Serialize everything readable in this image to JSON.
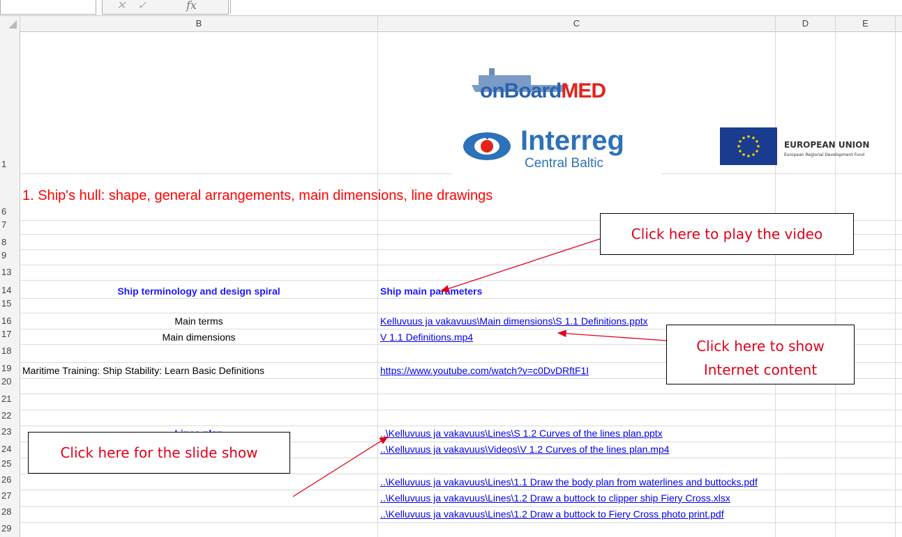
{
  "formula_bar": {
    "fx_label": "fx"
  },
  "columns": [
    "B",
    "C",
    "D",
    "E"
  ],
  "rows": [
    "1",
    "6",
    "7",
    "8",
    "9",
    "13",
    "14",
    "15",
    "16",
    "17",
    "18",
    "19",
    "20",
    "21",
    "22",
    "23",
    "24",
    "25",
    "26",
    "27",
    "28",
    "29"
  ],
  "logos": {
    "onboard_text_1": "on",
    "onboard_text_2": "Board",
    "onboard_text_3": "MED",
    "interreg_title": "Interreg",
    "interreg_subtitle": "Central Baltic",
    "eu_title": "EUROPEAN UNION",
    "eu_subtitle": "European Regional Development Fund"
  },
  "sheet": {
    "title": "1. Ship's hull: shape, general arrangements, main dimensions, line drawings",
    "header_b": "Ship terminology and design spiral",
    "header_c": "Ship main parameters",
    "b16": "Main terms",
    "c16": "Kelluvuus ja vakavuus\\Main dimensions\\S 1.1 Definitions.pptx",
    "b17": "Main dimensions",
    "c17": "V 1.1 Definitions.mp4",
    "b19": "Maritime Training: Ship Stability: Learn Basic Definitions",
    "c19": "https://www.youtube.com/watch?v=c0DvDRftF1I",
    "b23": "Lines plan",
    "c23": "..\\Kelluvuus ja vakavuus\\Lines\\S 1.2 Curves of the lines plan.pptx",
    "c24": "..\\Kelluvuus ja vakavuus\\Videos\\V 1.2 Curves of the lines plan.mp4",
    "c26": "..\\Kelluvuus ja vakavuus\\Lines\\1.1 Draw the body plan from waterlines and buttocks.pdf",
    "c27": "..\\Kelluvuus ja vakavuus\\Lines\\1.2 Draw a buttock to clipper ship Fiery Cross.xlsx",
    "c28": "..\\Kelluvuus ja vakavuus\\Lines\\1.2 Draw a buttock to Fiery Cross photo print.pdf"
  },
  "callouts": {
    "video": "Click here to play the video",
    "internet_line1": "Click here to show",
    "internet_line2": "Internet content",
    "slides": "Click here for the slide show"
  },
  "colors": {
    "link": "#0000ee",
    "title_red": "#ff0000",
    "callout_red": "#e0001b",
    "header_blue": "#1a1aff"
  }
}
